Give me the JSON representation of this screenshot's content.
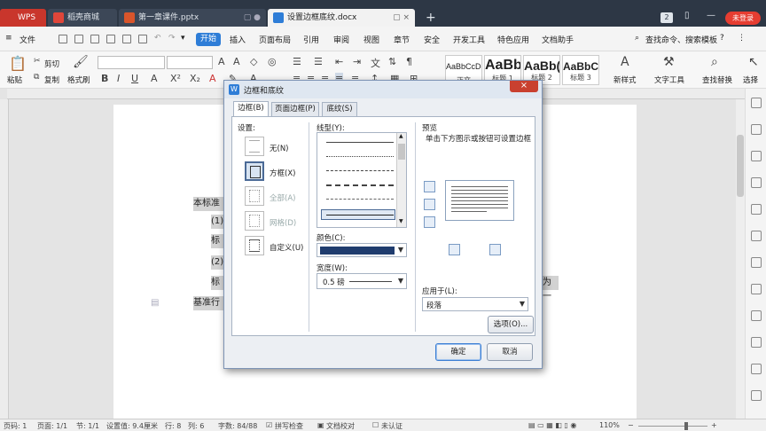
{
  "tabs": {
    "wps": "WPS",
    "t1": "稻壳商城",
    "t2": "第一章课件.pptx",
    "t3": "设置边框底纹.docx",
    "badge": "2",
    "login": "未登录"
  },
  "menu": {
    "file": "文件",
    "start": "开始",
    "insert": "插入",
    "layout": "页面布局",
    "ref": "引用",
    "review": "审阅",
    "view": "视图",
    "chapter": "章节",
    "security": "安全",
    "dev": "开发工具",
    "special": "特色应用",
    "assistant": "文档助手",
    "search": "查找命令、搜索模板",
    "help": "?"
  },
  "ribbon": {
    "paste": "粘贴",
    "cut": "剪切",
    "copy": "复制",
    "format_brush": "格式刷",
    "style1_sample": "AaBbCcDd",
    "style1_name": "正文",
    "style2_sample": "AaBb",
    "style2_name": "标题 1",
    "style3_sample": "AaBb(",
    "style3_name": "标题 2",
    "style4_sample": "AaBbC",
    "style4_name": "标题 3",
    "new_style": "新样式",
    "text_tool": "文字工具",
    "find_replace": "查找替换",
    "select": "选择"
  },
  "doc": {
    "line1": "本标准",
    "line2": "(1)",
    "line3": "标",
    "line4": "(2)",
    "line5": "标",
    "line6": "基准行",
    "line5_right": "为一"
  },
  "status": {
    "page": "页码: 1",
    "pages": "页面: 1/1",
    "section": "节: 1/1",
    "setting": "设置值: 9.4厘米",
    "row": "行: 8",
    "col": "列: 6",
    "words": "字数: 84/88",
    "spell": "拼写检查",
    "proof": "文档校对",
    "cert": "未认证",
    "zoom": "110%"
  },
  "dialog": {
    "title": "边框和底纹",
    "close": "×",
    "tab_border": "边框(B)",
    "tab_page_border": "页面边框(P)",
    "tab_shading": "底纹(S)",
    "settings_label": "设置:",
    "setting_none": "无(N)",
    "setting_box": "方框(X)",
    "setting_all": "全部(A)",
    "setting_grid": "网格(D)",
    "setting_custom": "自定义(U)",
    "style_label": "线型(Y):",
    "color_label": "颜色(C):",
    "color_value": "#1f3c6e",
    "width_label": "宽度(W):",
    "width_value": "0.5 磅",
    "preview_label": "预览",
    "preview_hint": "单击下方图示或按钮可设置边框",
    "apply_label": "应用于(L):",
    "apply_value": "段落",
    "options": "选项(O)...",
    "ok": "确定",
    "cancel": "取消"
  }
}
